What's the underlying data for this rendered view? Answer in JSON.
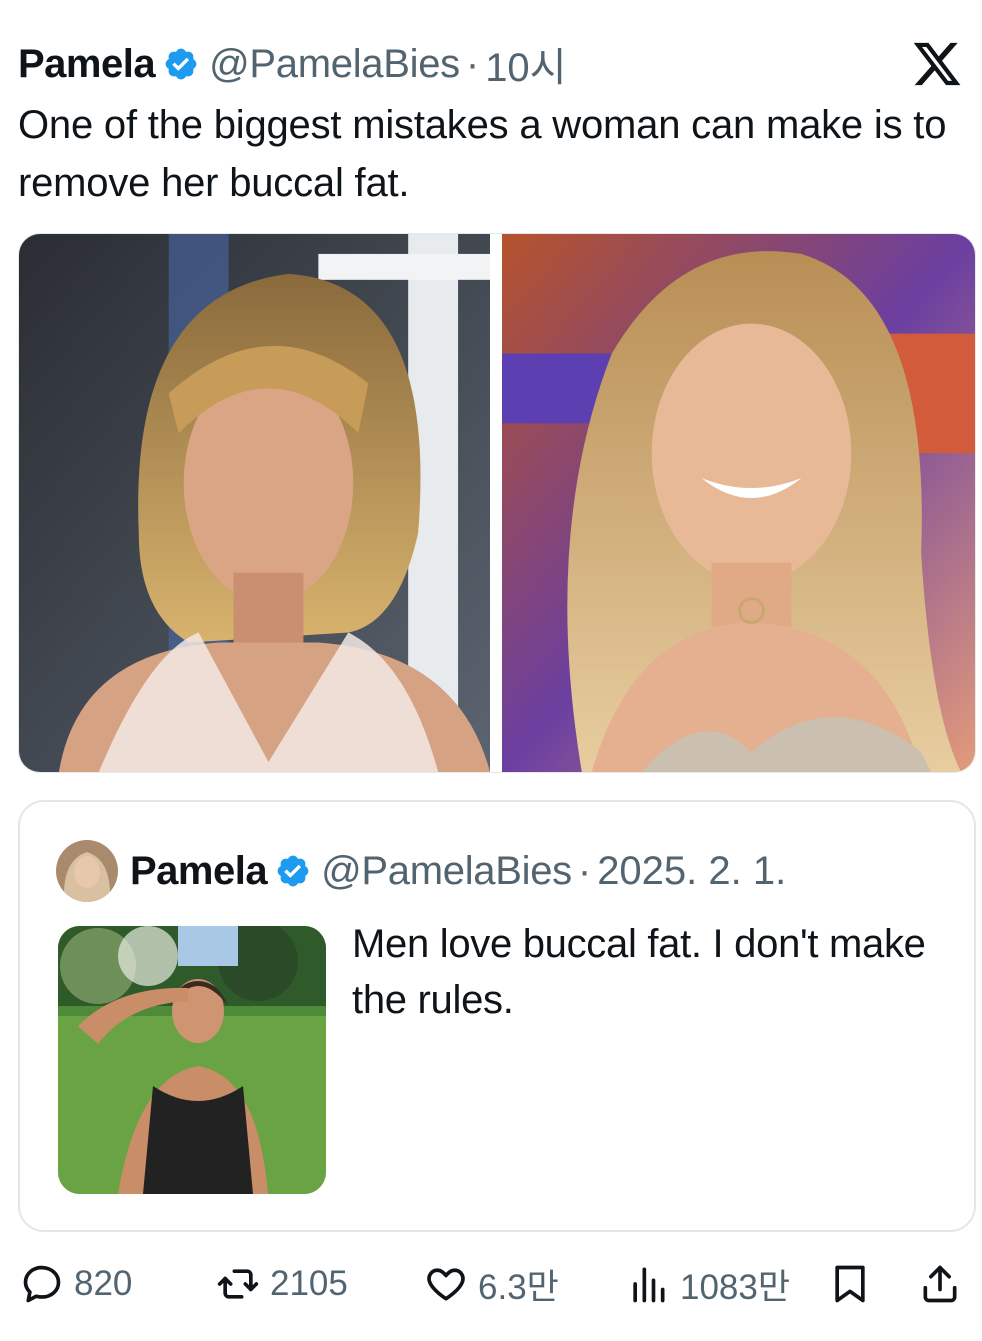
{
  "tweet": {
    "author_name": "Pamela",
    "handle": "@PamelaBies",
    "separator": "·",
    "time": "10시",
    "text": "One of the biggest mistakes a woman can make is to remove her buccal fat.",
    "logo_icon": "x-logo-icon",
    "verified_icon": "verified-badge-icon",
    "verified_color": "#1d9bf0",
    "media": [
      {
        "alt_icon": "photo-woman-bob-haircut"
      },
      {
        "alt_icon": "photo-woman-long-hair-smiling"
      }
    ]
  },
  "quoted_tweet": {
    "author_name": "Pamela",
    "handle": "@PamelaBies",
    "separator": "·",
    "date": "2025. 2. 1.",
    "text": "Men love buccal fat. I don't make the rules.",
    "avatar_icon": "avatar-icon",
    "media_icon": "photo-woman-garden"
  },
  "actions": {
    "reply": {
      "icon": "reply-icon",
      "count": "820"
    },
    "retweet": {
      "icon": "retweet-icon",
      "count": "2105"
    },
    "like": {
      "icon": "heart-icon",
      "count": "6.3만"
    },
    "views": {
      "icon": "views-icon",
      "count": "1083만"
    },
    "bookmark": {
      "icon": "bookmark-icon"
    },
    "share": {
      "icon": "share-icon"
    }
  },
  "colors": {
    "text": "#0f1419",
    "secondary": "#536471",
    "border": "#e3e7ea"
  }
}
